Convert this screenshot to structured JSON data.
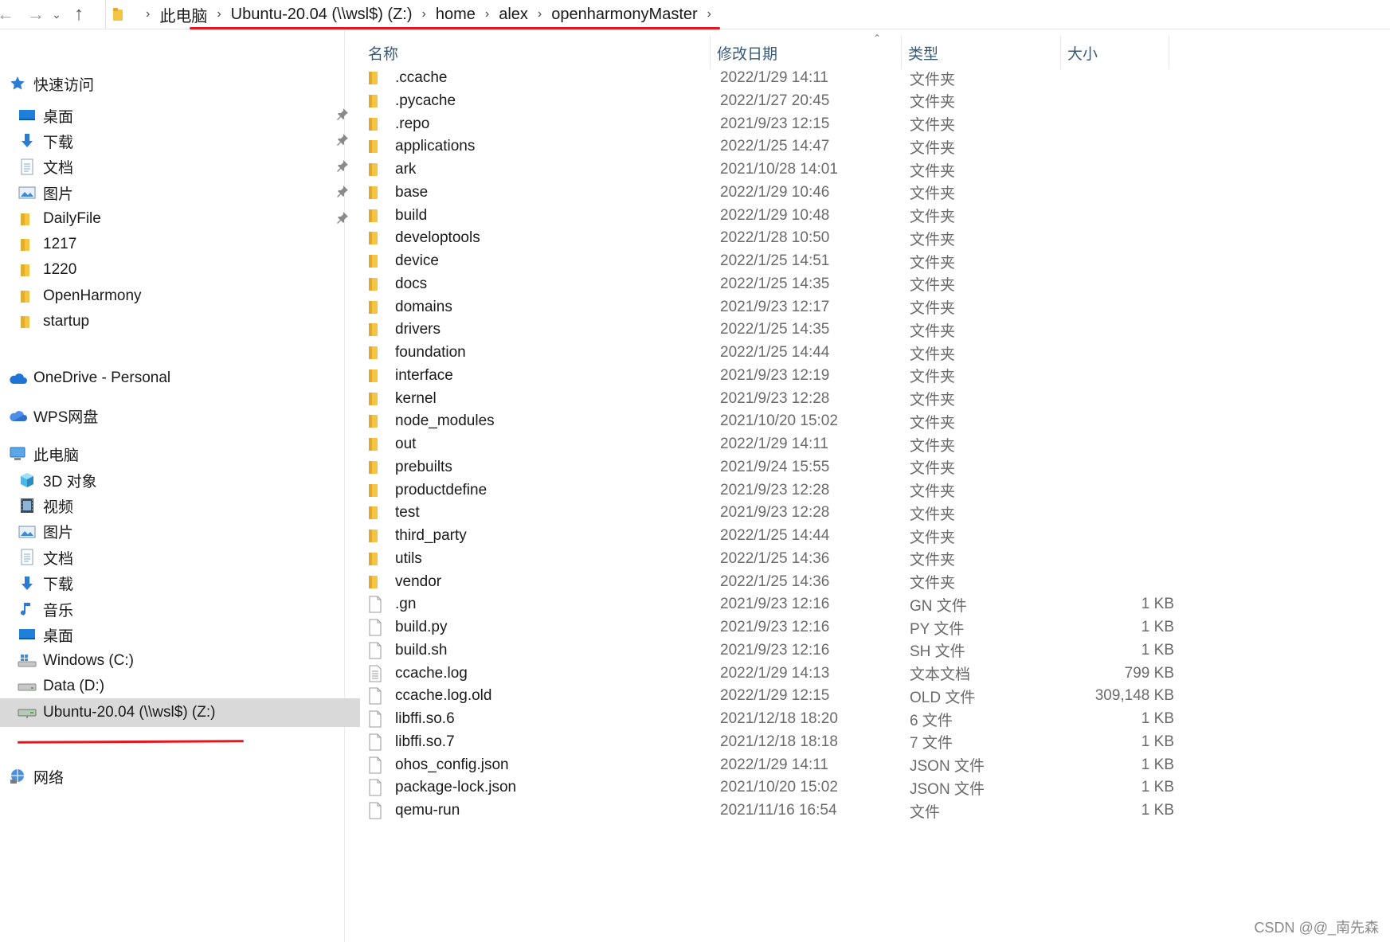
{
  "address_bar": {
    "crumbs": [
      "此电脑",
      "Ubuntu-20.04 (\\\\wsl$) (Z:)",
      "home",
      "alex",
      "openharmonyMaster"
    ]
  },
  "nav_pane": {
    "quick_access": {
      "label": "快速访问",
      "items": [
        {
          "label": "桌面",
          "icon": "desktop-icon",
          "pinned": true
        },
        {
          "label": "下载",
          "icon": "download-icon",
          "pinned": true
        },
        {
          "label": "文档",
          "icon": "document-icon",
          "pinned": true
        },
        {
          "label": "图片",
          "icon": "picture-icon",
          "pinned": true
        },
        {
          "label": "DailyFile",
          "icon": "folder-icon",
          "pinned": true
        },
        {
          "label": "1217",
          "icon": "folder-icon",
          "pinned": false
        },
        {
          "label": "1220",
          "icon": "folder-icon",
          "pinned": false
        },
        {
          "label": "OpenHarmony",
          "icon": "folder-icon",
          "pinned": false
        },
        {
          "label": "startup",
          "icon": "folder-icon",
          "pinned": false
        }
      ]
    },
    "onedrive": {
      "label": "OneDrive - Personal"
    },
    "wps": {
      "label": "WPS网盘"
    },
    "this_pc": {
      "label": "此电脑",
      "items": [
        {
          "label": "3D 对象",
          "icon": "3d-objects-icon"
        },
        {
          "label": "视频",
          "icon": "video-icon"
        },
        {
          "label": "图片",
          "icon": "picture-icon"
        },
        {
          "label": "文档",
          "icon": "document-icon"
        },
        {
          "label": "下载",
          "icon": "download-icon"
        },
        {
          "label": "音乐",
          "icon": "music-icon"
        },
        {
          "label": "桌面",
          "icon": "desktop-icon"
        },
        {
          "label": "Windows (C:)",
          "icon": "windows-drive-icon"
        },
        {
          "label": "Data (D:)",
          "icon": "drive-icon"
        },
        {
          "label": "Ubuntu-20.04 (\\\\wsl$) (Z:)",
          "icon": "network-drive-icon",
          "selected": true
        }
      ]
    },
    "network": {
      "label": "网络"
    }
  },
  "columns": {
    "name": "名称",
    "date": "修改日期",
    "type": "类型",
    "size": "大小"
  },
  "files": [
    {
      "name": ".ccache",
      "date": "2022/1/29 14:11",
      "type": "文件夹",
      "size": "",
      "kind": "folder"
    },
    {
      "name": ".pycache",
      "date": "2022/1/27 20:45",
      "type": "文件夹",
      "size": "",
      "kind": "folder"
    },
    {
      "name": ".repo",
      "date": "2021/9/23 12:15",
      "type": "文件夹",
      "size": "",
      "kind": "folder"
    },
    {
      "name": "applications",
      "date": "2022/1/25 14:47",
      "type": "文件夹",
      "size": "",
      "kind": "folder"
    },
    {
      "name": "ark",
      "date": "2021/10/28 14:01",
      "type": "文件夹",
      "size": "",
      "kind": "folder"
    },
    {
      "name": "base",
      "date": "2022/1/29 10:46",
      "type": "文件夹",
      "size": "",
      "kind": "folder"
    },
    {
      "name": "build",
      "date": "2022/1/29 10:48",
      "type": "文件夹",
      "size": "",
      "kind": "folder"
    },
    {
      "name": "developtools",
      "date": "2022/1/28 10:50",
      "type": "文件夹",
      "size": "",
      "kind": "folder"
    },
    {
      "name": "device",
      "date": "2022/1/25 14:51",
      "type": "文件夹",
      "size": "",
      "kind": "folder"
    },
    {
      "name": "docs",
      "date": "2022/1/25 14:35",
      "type": "文件夹",
      "size": "",
      "kind": "folder"
    },
    {
      "name": "domains",
      "date": "2021/9/23 12:17",
      "type": "文件夹",
      "size": "",
      "kind": "folder"
    },
    {
      "name": "drivers",
      "date": "2022/1/25 14:35",
      "type": "文件夹",
      "size": "",
      "kind": "folder"
    },
    {
      "name": "foundation",
      "date": "2022/1/25 14:44",
      "type": "文件夹",
      "size": "",
      "kind": "folder"
    },
    {
      "name": "interface",
      "date": "2021/9/23 12:19",
      "type": "文件夹",
      "size": "",
      "kind": "folder"
    },
    {
      "name": "kernel",
      "date": "2021/9/23 12:28",
      "type": "文件夹",
      "size": "",
      "kind": "folder"
    },
    {
      "name": "node_modules",
      "date": "2021/10/20 15:02",
      "type": "文件夹",
      "size": "",
      "kind": "folder"
    },
    {
      "name": "out",
      "date": "2022/1/29 14:11",
      "type": "文件夹",
      "size": "",
      "kind": "folder"
    },
    {
      "name": "prebuilts",
      "date": "2021/9/24 15:55",
      "type": "文件夹",
      "size": "",
      "kind": "folder"
    },
    {
      "name": "productdefine",
      "date": "2021/9/23 12:28",
      "type": "文件夹",
      "size": "",
      "kind": "folder"
    },
    {
      "name": "test",
      "date": "2021/9/23 12:28",
      "type": "文件夹",
      "size": "",
      "kind": "folder"
    },
    {
      "name": "third_party",
      "date": "2022/1/25 14:44",
      "type": "文件夹",
      "size": "",
      "kind": "folder"
    },
    {
      "name": "utils",
      "date": "2022/1/25 14:36",
      "type": "文件夹",
      "size": "",
      "kind": "folder"
    },
    {
      "name": "vendor",
      "date": "2022/1/25 14:36",
      "type": "文件夹",
      "size": "",
      "kind": "folder"
    },
    {
      "name": ".gn",
      "date": "2021/9/23 12:16",
      "type": "GN 文件",
      "size": "1 KB",
      "kind": "file"
    },
    {
      "name": "build.py",
      "date": "2021/9/23 12:16",
      "type": "PY 文件",
      "size": "1 KB",
      "kind": "file"
    },
    {
      "name": "build.sh",
      "date": "2021/9/23 12:16",
      "type": "SH 文件",
      "size": "1 KB",
      "kind": "file"
    },
    {
      "name": "ccache.log",
      "date": "2022/1/29 14:13",
      "type": "文本文档",
      "size": "799 KB",
      "kind": "text"
    },
    {
      "name": "ccache.log.old",
      "date": "2022/1/29 12:15",
      "type": "OLD 文件",
      "size": "309,148 KB",
      "kind": "file"
    },
    {
      "name": "libffi.so.6",
      "date": "2021/12/18 18:20",
      "type": "6 文件",
      "size": "1 KB",
      "kind": "file"
    },
    {
      "name": "libffi.so.7",
      "date": "2021/12/18 18:18",
      "type": "7 文件",
      "size": "1 KB",
      "kind": "file"
    },
    {
      "name": "ohos_config.json",
      "date": "2022/1/29 14:11",
      "type": "JSON 文件",
      "size": "1 KB",
      "kind": "file"
    },
    {
      "name": "package-lock.json",
      "date": "2021/10/20 15:02",
      "type": "JSON 文件",
      "size": "1 KB",
      "kind": "file"
    },
    {
      "name": "qemu-run",
      "date": "2021/11/16 16:54",
      "type": "文件",
      "size": "1 KB",
      "kind": "file"
    }
  ],
  "watermark": "CSDN @@_南先森",
  "colors": {
    "accent_line": "#e8141e",
    "selected_bg": "#d9d9d9",
    "folder": "#f4c542",
    "header_text": "#3a5a78"
  }
}
